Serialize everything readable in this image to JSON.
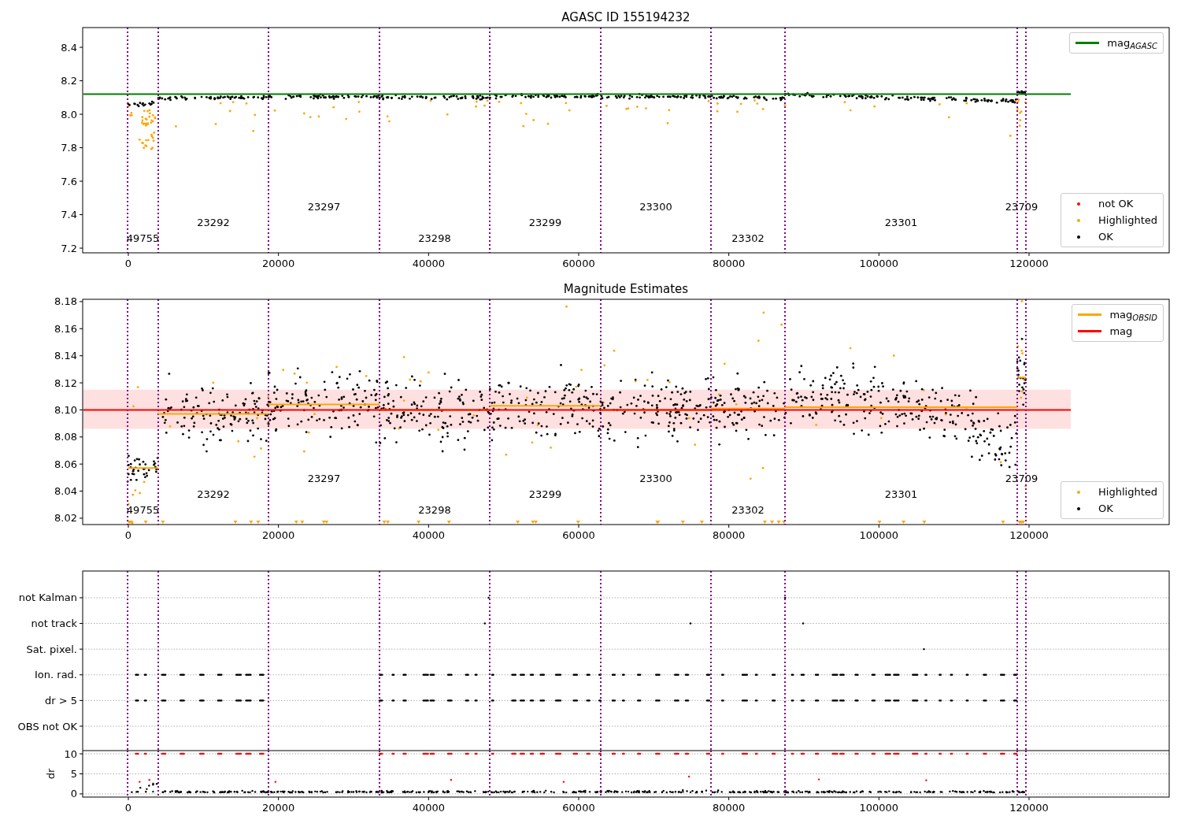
{
  "figure": {
    "panels": [
      {
        "chart_data": {
          "type": "scatter",
          "title": "AGASC ID 155194232",
          "xlim": [
            -6084,
            138672
          ],
          "ylim": [
            7.172,
            8.518
          ],
          "xticks": [
            0,
            20000,
            40000,
            60000,
            80000,
            100000,
            120000
          ],
          "yticks": [
            {
              "value": 7.2,
              "label": "7.2"
            },
            {
              "value": 7.4,
              "label": "7.4"
            },
            {
              "value": 7.6,
              "label": "7.6"
            },
            {
              "value": 7.8,
              "label": "7.8"
            },
            {
              "value": 8.0,
              "label": "8.0"
            },
            {
              "value": 8.2,
              "label": "8.2"
            },
            {
              "value": 8.4,
              "label": "8.4"
            }
          ],
          "series": [
            {
              "name": "mag$_{AGASC}$",
              "type": "line",
              "color": "#008000",
              "x": [
                -6000,
                125560
              ],
              "values": [
                8.12,
                8.12
              ]
            },
            {
              "name": "not OK",
              "type": "scatter",
              "color": "#ff0000"
            },
            {
              "name": "Highlighted",
              "type": "scatter",
              "color": "#ffa500"
            },
            {
              "name": "OK",
              "type": "scatter",
              "color": "#000000"
            }
          ],
          "annotations": [
            "49755",
            "23292",
            "23297",
            "23298",
            "23299",
            "23300",
            "23302",
            "23301",
            "23709"
          ]
        }
      },
      {
        "chart_data": {
          "type": "scatter",
          "title": "Magnitude Estimates",
          "xlim": [
            -6084,
            138672
          ],
          "ylim": [
            8.0153,
            8.1817
          ],
          "xticks": [
            0,
            20000,
            40000,
            60000,
            80000,
            100000,
            120000
          ],
          "yticks": [
            {
              "value": 8.02,
              "label": "8.02"
            },
            {
              "value": 8.04,
              "label": "8.04"
            },
            {
              "value": 8.06,
              "label": "8.06"
            },
            {
              "value": 8.08,
              "label": "8.08"
            },
            {
              "value": 8.1,
              "label": "8.10"
            },
            {
              "value": 8.12,
              "label": "8.12"
            },
            {
              "value": 8.14,
              "label": "8.14"
            },
            {
              "value": 8.16,
              "label": "8.16"
            },
            {
              "value": 8.18,
              "label": "8.18"
            }
          ],
          "series": [
            {
              "name": "mag$_{OBSID}$",
              "type": "line",
              "color": "#ffa500",
              "x": [
                0,
                3986,
                3986,
                18672,
                18672,
                33463,
                33463,
                48148,
                48148,
                62939,
                62939,
                77625,
                77625,
                87486,
                87486,
                118430,
                118430,
                119584
              ],
              "values": [
                8.057,
                8.057,
                8.097,
                8.097,
                8.104,
                8.104,
                8.1,
                8.1,
                8.103,
                8.103,
                8.1,
                8.1,
                8.101,
                8.101,
                8.102,
                8.102,
                8.124,
                8.124
              ]
            },
            {
              "name": "mag",
              "type": "line",
              "color": "#ff0000",
              "x": [
                -6000,
                125560
              ],
              "values": [
                8.1,
                8.1
              ]
            },
            {
              "name": "Highlighted",
              "type": "scatter",
              "color": "#ffa500"
            },
            {
              "name": "OK",
              "type": "scatter",
              "color": "#000000"
            }
          ],
          "bands": [
            {
              "axis": "y",
              "from": 8.086,
              "to": 8.115,
              "color": "#ffe0e0"
            }
          ],
          "annotations": [
            "49755",
            "23292",
            "23297",
            "23298",
            "23299",
            "23300",
            "23302",
            "23301",
            "23709"
          ]
        }
      },
      {
        "chart_data": {
          "type": "scatter",
          "grid": true,
          "xlim": [
            -6084,
            138672
          ],
          "orientation": "horizontal",
          "categories": [
            "not Kalman",
            "not track",
            "Sat. pixel.",
            "Ion. rad.",
            "dr > 5",
            "OBS not OK"
          ]
        }
      },
      {
        "chart_data": {
          "type": "scatter",
          "grid": true,
          "ylabel": "dr",
          "xlim": [
            -6084,
            138672
          ],
          "ylim": [
            -0.8,
            10.8
          ],
          "xticks": [
            0,
            20000,
            40000,
            60000,
            80000,
            100000,
            120000
          ],
          "yticks": [
            0,
            5,
            10
          ]
        }
      }
    ]
  }
}
